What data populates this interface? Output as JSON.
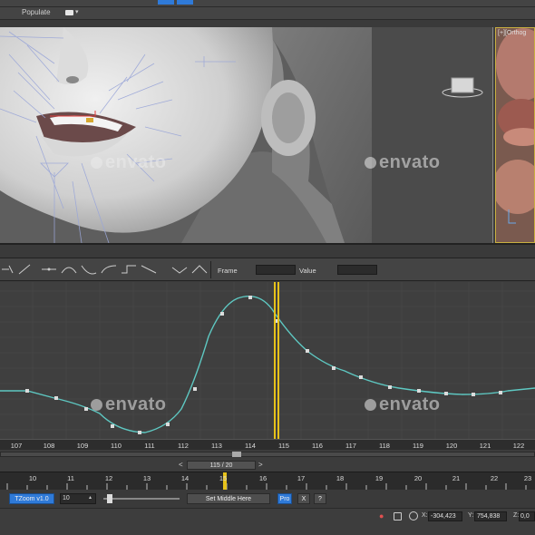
{
  "menu": {
    "populate_label": "Populate"
  },
  "viewport_side": {
    "label": "[+][Orthog"
  },
  "watermarks": [
    "envato",
    "envato",
    "envato",
    "envato"
  ],
  "curve_editor": {
    "frame_label": "Frame",
    "value_label": "Value",
    "x_ruler": [
      "107",
      "108",
      "109",
      "110",
      "111",
      "112",
      "113",
      "114",
      "115",
      "116",
      "117",
      "118",
      "119",
      "120",
      "121",
      "122"
    ]
  },
  "range_bar": {
    "readout": "115 / 20",
    "prev": "<",
    "next": ">"
  },
  "timeline": {
    "ticks": [
      "10",
      "11",
      "12",
      "13",
      "14",
      "15",
      "16",
      "17",
      "18",
      "19",
      "20",
      "21",
      "22",
      "23"
    ]
  },
  "controls": {
    "tzoom_label": "TZoom v1.0",
    "zoom_value": "10",
    "set_middle_label": "Set Middle Here",
    "pro_label": "Pro",
    "x_label": "X",
    "help_label": "?"
  },
  "status": {
    "x_label": "X:",
    "x_value": "-304,423",
    "y_label": "Y:",
    "y_value": "754,838",
    "z_label": "Z:",
    "z_value": "0,0"
  },
  "colors": {
    "accent": "#2f7ad8",
    "curve": "#55c4c0",
    "time_marker": "#e6c21a"
  }
}
